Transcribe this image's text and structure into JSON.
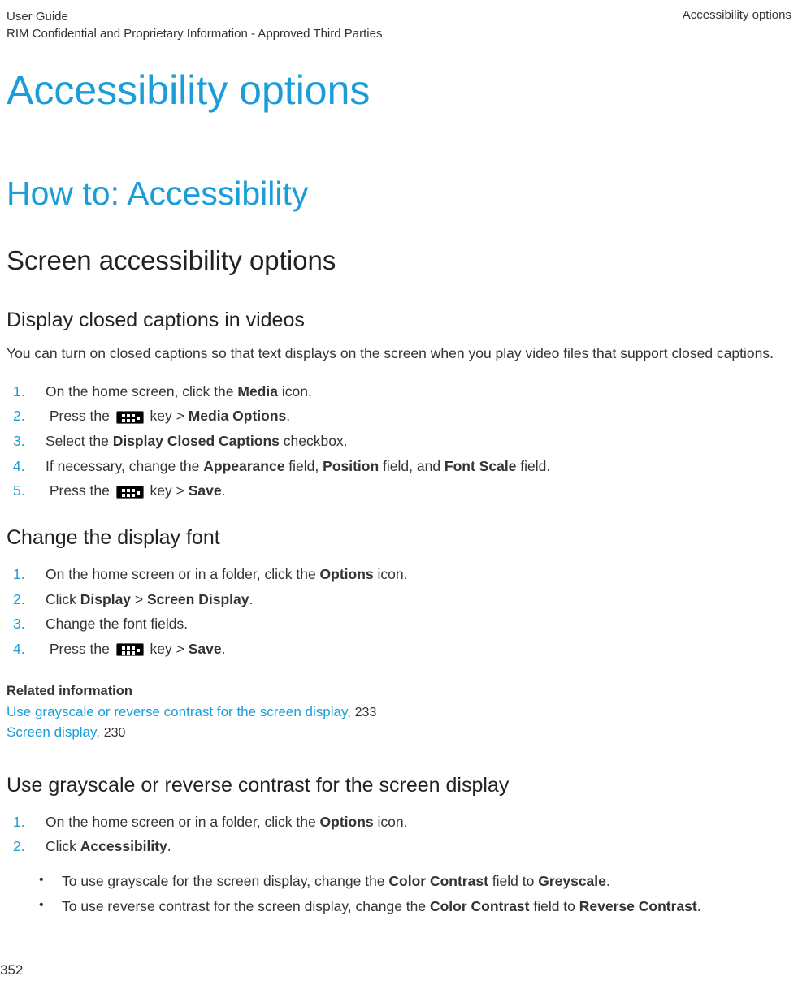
{
  "header": {
    "left_line1": "User Guide",
    "left_line2": "RIM Confidential and Proprietary Information - Approved Third Parties",
    "right": "Accessibility options"
  },
  "title": "Accessibility options",
  "section1": {
    "heading": "How to: Accessibility"
  },
  "section2": {
    "heading": "Screen accessibility options"
  },
  "cc": {
    "heading": "Display closed captions in videos",
    "intro": "You can turn on closed captions so that text displays on the screen when you play video files that support closed captions.",
    "step1_a": "On the home screen, click the ",
    "step1_b": "Media",
    "step1_c": " icon.",
    "step2_a": "Press the ",
    "step2_b": " key > ",
    "step2_c": "Media Options",
    "step2_d": ".",
    "step3_a": "Select the ",
    "step3_b": "Display Closed Captions",
    "step3_c": " checkbox.",
    "step4_a": "If necessary, change the ",
    "step4_b": "Appearance",
    "step4_c": " field, ",
    "step4_d": "Position",
    "step4_e": " field, and ",
    "step4_f": "Font Scale",
    "step4_g": " field.",
    "step5_a": "Press the ",
    "step5_b": " key > ",
    "step5_c": "Save",
    "step5_d": "."
  },
  "font": {
    "heading": "Change the display font",
    "step1_a": "On the home screen or in a folder, click the ",
    "step1_b": "Options",
    "step1_c": " icon.",
    "step2_a": "Click ",
    "step2_b": "Display",
    "step2_c": " > ",
    "step2_d": "Screen Display",
    "step2_e": ".",
    "step3": "Change the font fields.",
    "step4_a": "Press the ",
    "step4_b": " key > ",
    "step4_c": "Save",
    "step4_d": "."
  },
  "related": {
    "heading": "Related information",
    "link1_text": "Use grayscale or reverse contrast for the screen display, ",
    "link1_num": "233",
    "link2_text": "Screen display, ",
    "link2_num": "230"
  },
  "gray": {
    "heading": "Use grayscale or reverse contrast for the screen display",
    "step1_a": "On the home screen or in a folder, click the ",
    "step1_b": "Options",
    "step1_c": " icon.",
    "step2_a": "Click ",
    "step2_b": "Accessibility",
    "step2_c": ".",
    "b1_a": "To use grayscale for the screen display, change the ",
    "b1_b": "Color Contrast",
    "b1_c": " field to ",
    "b1_d": "Greyscale",
    "b1_e": ".",
    "b2_a": "To use reverse contrast for the screen display, change the ",
    "b2_b": "Color Contrast",
    "b2_c": " field to ",
    "b2_d": "Reverse Contrast",
    "b2_e": "."
  },
  "page_number": "352"
}
